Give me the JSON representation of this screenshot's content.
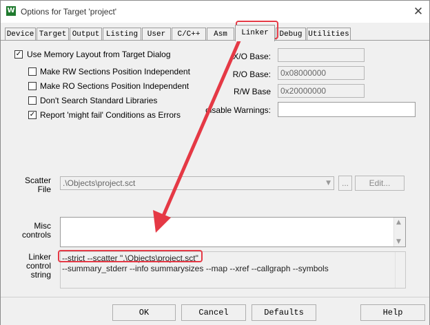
{
  "window": {
    "title": "Options for Target 'project'",
    "app_icon": "W",
    "close_glyph": "✕"
  },
  "tabs": [
    {
      "label": "Device",
      "active": false
    },
    {
      "label": "Target",
      "active": false
    },
    {
      "label": "Output",
      "active": false
    },
    {
      "label": "Listing",
      "active": false
    },
    {
      "label": "User",
      "active": false
    },
    {
      "label": "C/C++",
      "active": false
    },
    {
      "label": "Asm",
      "active": false
    },
    {
      "label": "Linker",
      "active": true
    },
    {
      "label": "Debug",
      "active": false
    },
    {
      "label": "Utilities",
      "active": false
    }
  ],
  "options": {
    "use_memory_layout": {
      "label": "Use Memory Layout from Target Dialog",
      "checked": true
    },
    "make_rw_pi": {
      "label": "Make RW Sections Position Independent",
      "checked": false
    },
    "make_ro_pi": {
      "label": "Make RO Sections Position Independent",
      "checked": false
    },
    "dont_search_std_libs": {
      "label": "Don't Search Standard Libraries",
      "checked": false
    },
    "report_might_fail": {
      "label": "Report 'might fail' Conditions as Errors",
      "checked": true
    }
  },
  "bases": {
    "xo_label": "X/O Base:",
    "xo_value": "",
    "ro_label": "R/O Base:",
    "ro_value": "0x08000000",
    "rw_label": "R/W Base",
    "rw_value": "0x20000000",
    "disable_warnings_label": "disable Warnings:",
    "disable_warnings_value": ""
  },
  "scatter": {
    "label_line1": "Scatter",
    "label_line2": "File",
    "value": ".\\Objects\\project.sct",
    "browse_label": "...",
    "edit_label": "Edit..."
  },
  "misc": {
    "label_line1": "Misc",
    "label_line2": "controls",
    "value": ""
  },
  "linker_control": {
    "label_line1": "Linker",
    "label_line2": "control",
    "label_line3": "string",
    "line1": "--strict --scatter \".\\Objects\\project.sct\"",
    "line2": "--summary_stderr --info summarysizes --map --xref --callgraph --symbols"
  },
  "buttons": {
    "ok": "OK",
    "cancel": "Cancel",
    "defaults": "Defaults",
    "help": "Help"
  },
  "annotation": {
    "color": "#e53945"
  }
}
